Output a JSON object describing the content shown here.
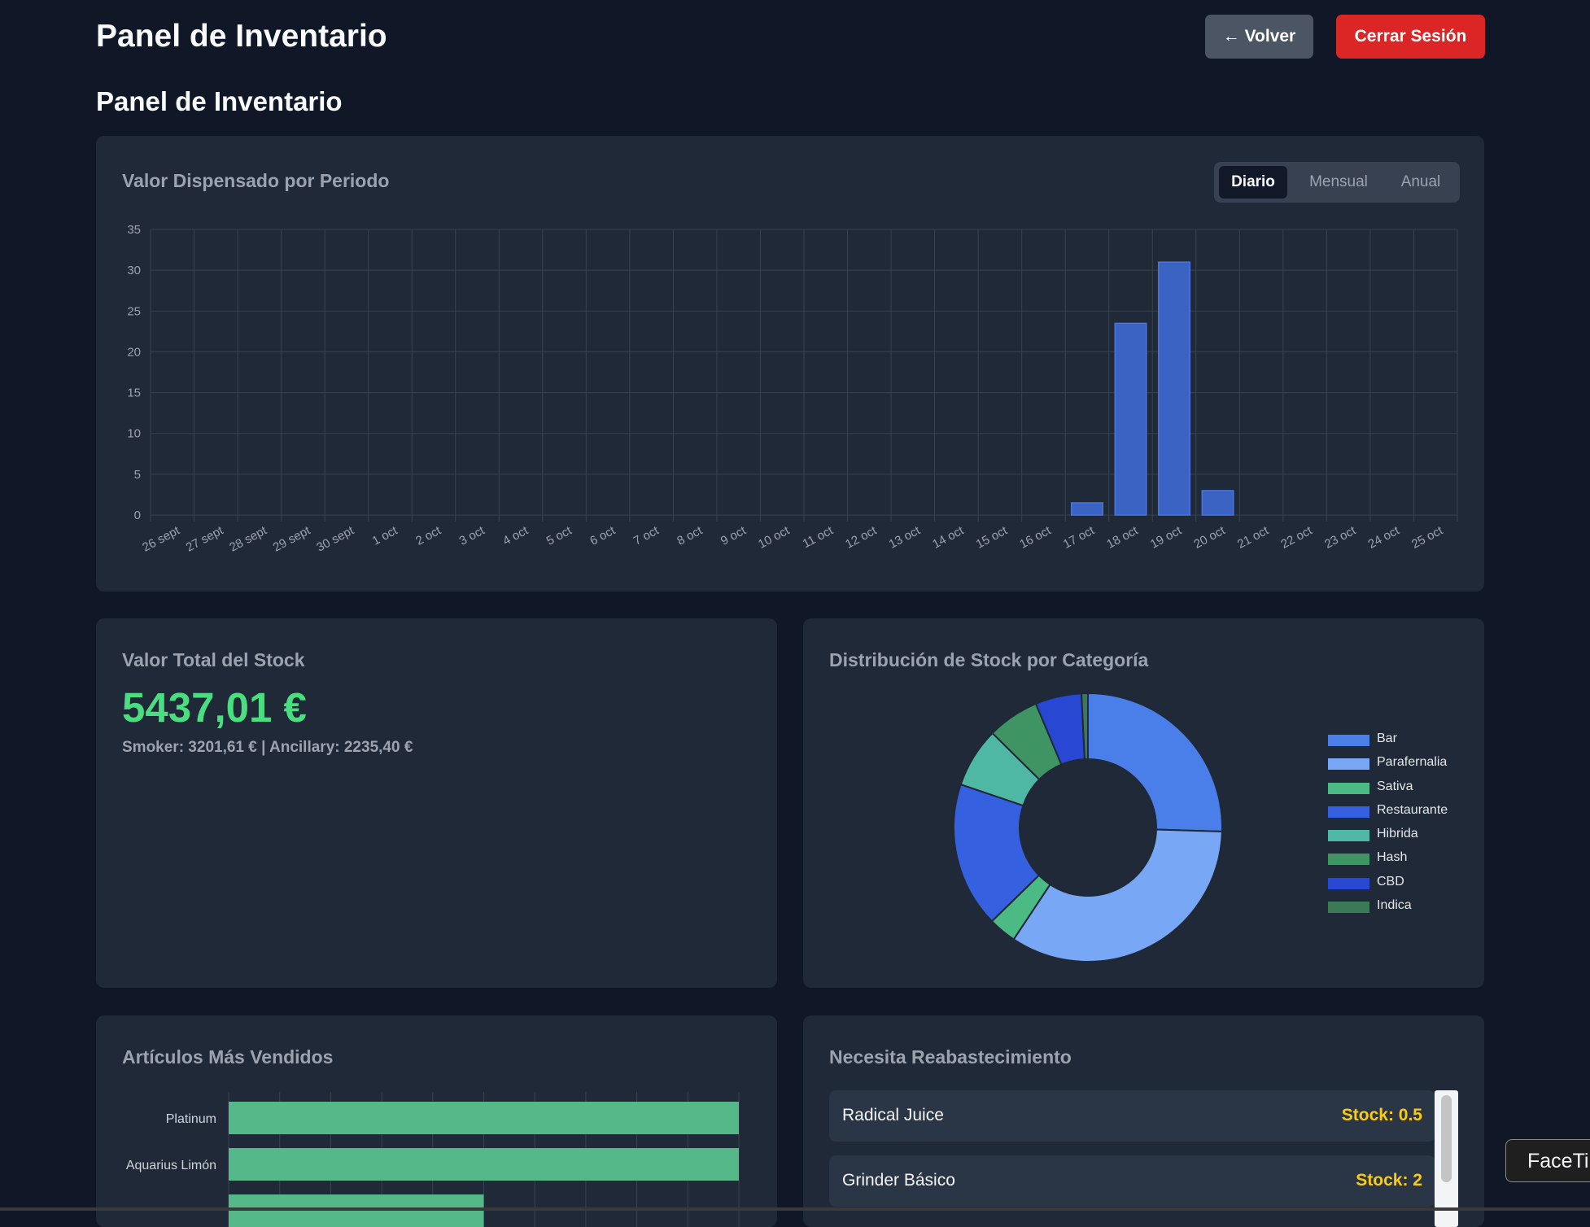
{
  "header": {
    "title": "Panel de Inventario",
    "back_label": "← Volver",
    "logout_label": "Cerrar Sesión"
  },
  "subtitle": "Panel de Inventario",
  "dispensed_card": {
    "title": "Valor Dispensado por Periodo",
    "toggle": [
      "Diario",
      "Mensual",
      "Anual"
    ],
    "active_toggle": "Diario"
  },
  "stock_card": {
    "title": "Valor Total del Stock",
    "total": "5437,01 €",
    "breakdown": "Smoker: 3201,61 € | Ancillary: 2235,40 €"
  },
  "distribution_card": {
    "title": "Distribución de Stock por Categoría"
  },
  "top_card": {
    "title": "Artículos Más Vendidos"
  },
  "restock_card": {
    "title": "Necesita Reabastecimiento",
    "items": [
      {
        "name": "Radical Juice",
        "stock": "Stock: 0.5"
      },
      {
        "name": "Grinder Básico",
        "stock": "Stock: 2"
      }
    ]
  },
  "facetime": {
    "label": "FaceTi"
  },
  "colors": {
    "background": "#101827",
    "card": "#1f2937",
    "bar_blue": "#3b63c4",
    "total_green": "#4ade80",
    "stock_yellow": "#facc15",
    "logout_red": "#dc2626"
  },
  "chart_data": [
    {
      "type": "bar",
      "categories": [
        "26 sept",
        "27 sept",
        "28 sept",
        "29 sept",
        "30 sept",
        "1 oct",
        "2 oct",
        "3 oct",
        "4 oct",
        "5 oct",
        "6 oct",
        "7 oct",
        "8 oct",
        "9 oct",
        "10 oct",
        "11 oct",
        "12 oct",
        "13 oct",
        "14 oct",
        "15 oct",
        "16 oct",
        "17 oct",
        "18 oct",
        "19 oct",
        "20 oct",
        "21 oct",
        "22 oct",
        "23 oct",
        "24 oct",
        "25 oct"
      ],
      "values": [
        0,
        0,
        0,
        0,
        0,
        0,
        0,
        0,
        0,
        0,
        0,
        0,
        0,
        0,
        0,
        0,
        0,
        0,
        0,
        0,
        0,
        1.5,
        23.5,
        31,
        3,
        0,
        0,
        0,
        0,
        0
      ],
      "ylim": [
        0,
        35
      ],
      "yticks": [
        0,
        5,
        10,
        15,
        20,
        25,
        30,
        35
      ],
      "grid": true,
      "legend": "none"
    },
    {
      "type": "pie",
      "donut": true,
      "labels": [
        "Bar",
        "Parafernalia",
        "Sativa",
        "Restaurante",
        "Hibrida",
        "Hash",
        "CBD",
        "Indica"
      ],
      "values": [
        26.5,
        35.2,
        3.5,
        18.2,
        7.5,
        6.5,
        5.8,
        0.8
      ],
      "colors": [
        "#4a7ee8",
        "#78a7f5",
        "#4bba85",
        "#3560e0",
        "#4fb8a4",
        "#3f9464",
        "#2847d2",
        "#3a7a56"
      ],
      "legend": "right"
    },
    {
      "type": "bar",
      "orientation": "horizontal",
      "categories": [
        "Platinum",
        "Aquarius Limón"
      ],
      "values": [
        10,
        10
      ],
      "note_visible_partial_third_bar": 5,
      "color": "#55b888",
      "grid": true
    }
  ]
}
